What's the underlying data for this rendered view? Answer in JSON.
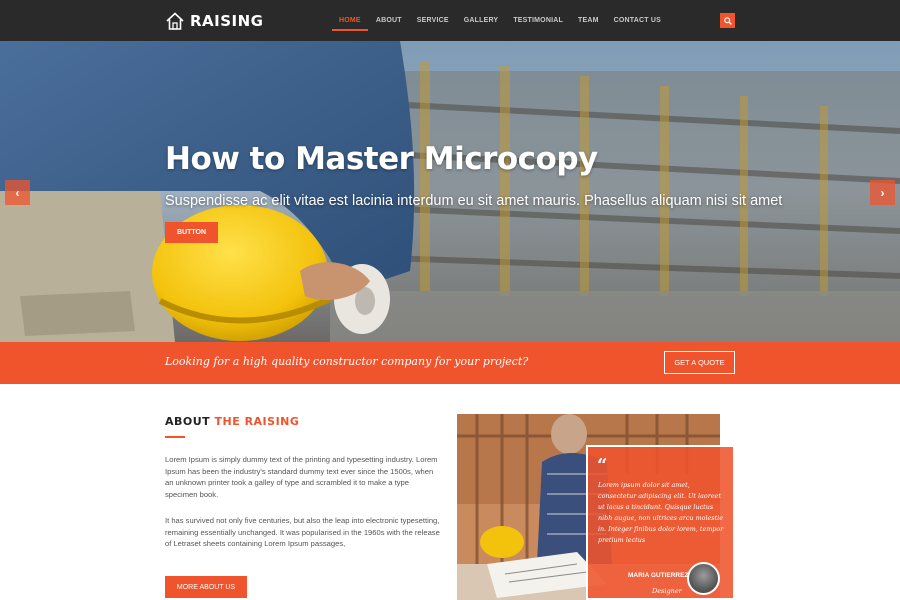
{
  "brand": {
    "name": "RAISING",
    "logo_icon": "house-icon"
  },
  "nav": {
    "items": [
      {
        "label": "HOME",
        "active": true
      },
      {
        "label": "ABOUT",
        "active": false
      },
      {
        "label": "SERVICE",
        "active": false
      },
      {
        "label": "GALLERY",
        "active": false
      },
      {
        "label": "TESTIMONIAL",
        "active": false
      },
      {
        "label": "TEAM",
        "active": false
      },
      {
        "label": "CONTACT US",
        "active": false
      }
    ],
    "search_icon": "search-icon"
  },
  "hero": {
    "title": "How to Master Microcopy",
    "subtitle": "Suspendisse ac elit vitae est lacinia interdum eu sit amet mauris. Phasellus aliquam nisi sit amet",
    "button_label": "BUTTON",
    "prev_label": "‹",
    "next_label": "›"
  },
  "quote_band": {
    "text": "Looking for a high quality constructor company for your project?",
    "button_label": "GET A QUOTE"
  },
  "about": {
    "heading_plain": "ABOUT ",
    "heading_accent": "THE RAISING",
    "paragraph1": "Lorem Ipsum is simply dummy text of the printing and typesetting industry. Lorem Ipsum has been the industry's standard dummy text ever since the 1500s, when an unknown printer took a galley of type and scrambled it to make a type specimen book.",
    "paragraph2": "It has survived not only five centuries, but also the leap into electronic typesetting, remaining essentially unchanged. It was popularised in the 1960s with the release of Letraset sheets containing Lorem Ipsum passages,",
    "button_label": "MORE ABOUT US"
  },
  "testimonial": {
    "quote_mark": "“",
    "text": "Lorem ipsum dolor sit amet, consectetur adipiscing elit. Ut laoreet ut lacus a tincidunt. Quisque luctus nibh augue, non ultrices arcu molestie in. Integer finibus dolor lorem, tempor pretium lectus",
    "name": "MARIA GUTIERREZ",
    "role": "Designer"
  },
  "colors": {
    "accent": "#f0542d",
    "navbar": "#2a2a2a"
  }
}
